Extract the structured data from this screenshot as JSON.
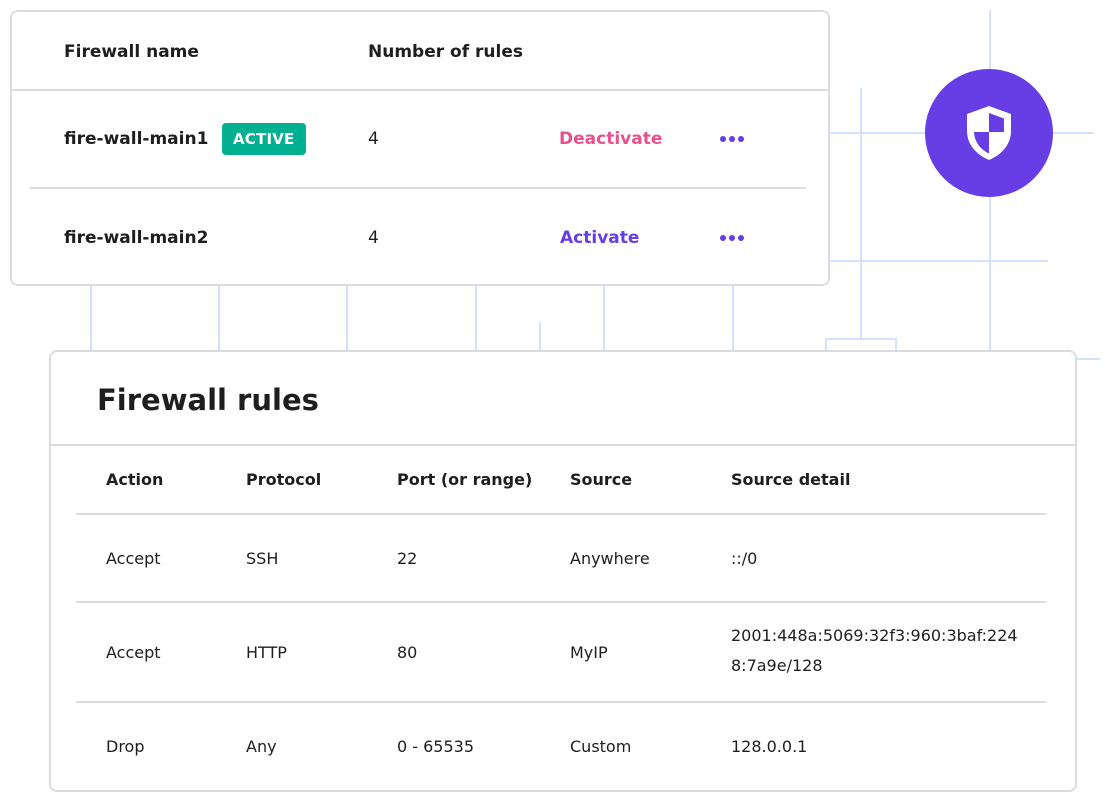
{
  "firewalls": {
    "headers": {
      "name": "Firewall name",
      "rules": "Number of rules"
    },
    "rows": [
      {
        "name": "fire-wall-main1",
        "status": "ACTIVE",
        "rules": "4",
        "action": "Deactivate"
      },
      {
        "name": "fire-wall-main2",
        "status": "",
        "rules": "4",
        "action": "Activate"
      }
    ]
  },
  "rules": {
    "title": "Firewall rules",
    "headers": {
      "action": "Action",
      "protocol": "Protocol",
      "port": "Port (or range)",
      "source": "Source",
      "source_detail": "Source detail"
    },
    "rows": [
      {
        "action": "Accept",
        "protocol": "SSH",
        "port": "22",
        "source": "Anywhere",
        "source_detail": "::/0"
      },
      {
        "action": "Accept",
        "protocol": "HTTP",
        "port": "80",
        "source": "MyIP",
        "source_detail": "2001:448a:5069:32f3:960:3baf:2248:7a9e/128"
      },
      {
        "action": "Drop",
        "protocol": "Any",
        "port": "0 - 65535",
        "source": "Custom",
        "source_detail": "128.0.0.1"
      }
    ]
  },
  "colors": {
    "accent": "#673de6",
    "active_badge": "#00b090",
    "deactivate": "#e9518e",
    "connector_lines": "#d5dfff"
  },
  "icons": {
    "shield": "shield-icon",
    "more": "more-dots-icon"
  }
}
